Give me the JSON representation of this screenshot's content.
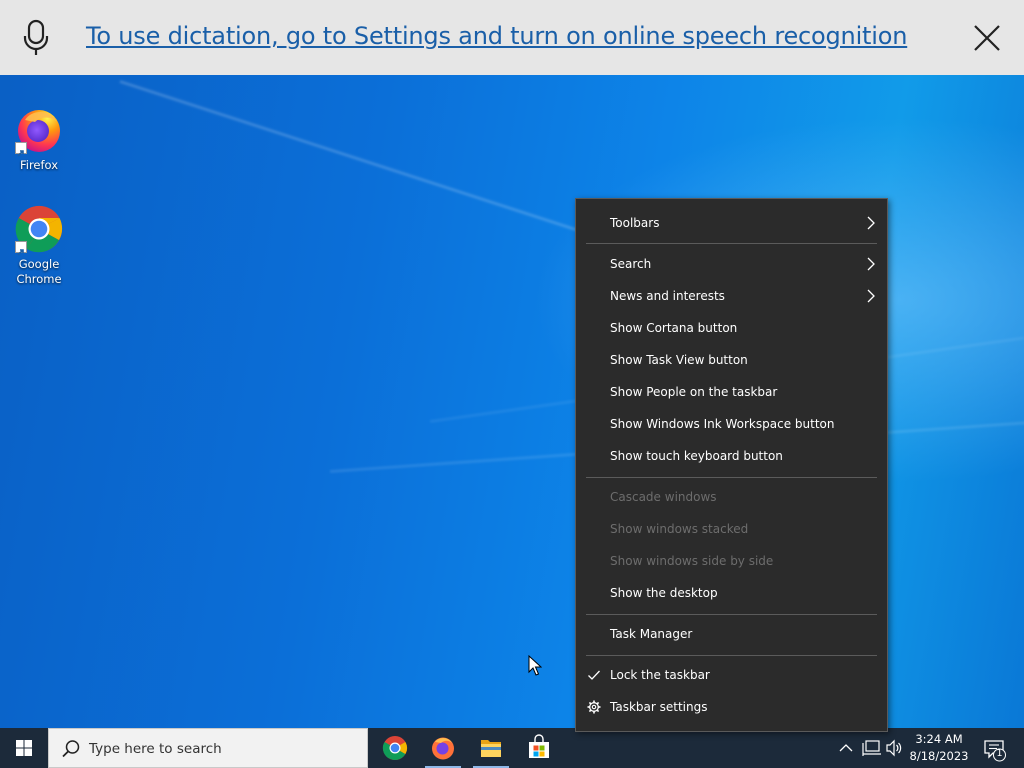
{
  "banner": {
    "message": "To use dictation, go to Settings and turn on online speech recognition",
    "mic_icon": "microphone-icon",
    "close_icon": "close-icon"
  },
  "desktop": {
    "icons": [
      {
        "label": "Firefox",
        "icon": "firefox-icon"
      },
      {
        "label": "Google Chrome",
        "icon": "chrome-icon"
      }
    ]
  },
  "context_menu": {
    "items": [
      {
        "label": "Toolbars",
        "submenu": true,
        "enabled": true
      },
      {
        "label": "Search",
        "submenu": true,
        "enabled": true
      },
      {
        "label": "News and interests",
        "submenu": true,
        "enabled": true
      },
      {
        "label": "Show Cortana button",
        "enabled": true
      },
      {
        "label": "Show Task View button",
        "enabled": true
      },
      {
        "label": "Show People on the taskbar",
        "enabled": true
      },
      {
        "label": "Show Windows Ink Workspace button",
        "enabled": true
      },
      {
        "label": "Show touch keyboard button",
        "enabled": true
      },
      {
        "label": "Cascade windows",
        "enabled": false
      },
      {
        "label": "Show windows stacked",
        "enabled": false
      },
      {
        "label": "Show windows side by side",
        "enabled": false
      },
      {
        "label": "Show the desktop",
        "enabled": true
      },
      {
        "label": "Task Manager",
        "enabled": true
      },
      {
        "label": "Lock the taskbar",
        "enabled": true,
        "checked": true,
        "lead_icon": "checkmark-icon"
      },
      {
        "label": "Taskbar settings",
        "enabled": true,
        "lead_icon": "gear-icon"
      }
    ]
  },
  "taskbar": {
    "search_placeholder": "Type here to search",
    "pinned_apps": [
      {
        "name": "Google Chrome",
        "icon": "chrome-icon"
      },
      {
        "name": "Firefox",
        "icon": "firefox-icon"
      },
      {
        "name": "File Explorer",
        "icon": "folder-icon"
      },
      {
        "name": "Microsoft Store",
        "icon": "store-icon"
      }
    ],
    "clock_time": "3:24 AM",
    "clock_date": "8/18/2023",
    "notification_count": "1"
  },
  "colors": {
    "banner_bg": "#e6e6e6",
    "banner_link": "#1a5fa8",
    "menu_bg": "#2b2b2b",
    "menu_disabled": "#6d6d6d",
    "taskbar_bg": "#1c2a3a"
  }
}
